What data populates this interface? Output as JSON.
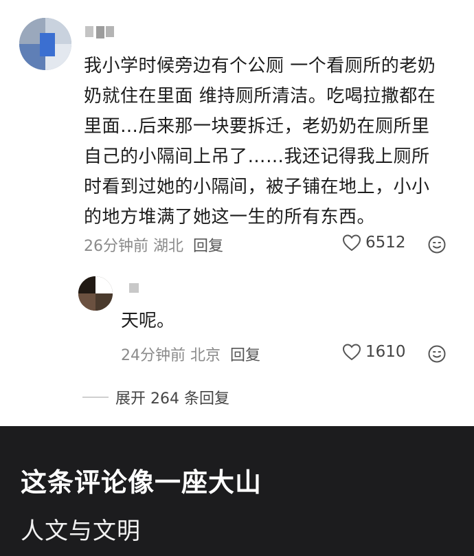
{
  "comment": {
    "lines": [
      "我小学时候旁边有个公厕 一个看厕所的老奶",
      "奶就住在里面 维持厕所清洁。吃喝拉撒都在",
      "里面…后来那一块要拆迁，老奶奶在厕所里",
      "自己的小隔间上吊了……我还记得我上厕所",
      "时看到过她的小隔间，被子铺在地上，小小",
      "的地方堆满了她这一生的所有东西。"
    ],
    "time_location": "26分钟前 湖北",
    "reply_label": "回复",
    "like_count": "6512",
    "like_icon": "heart-outline",
    "emoji_icon": "smiley-face"
  },
  "reply": {
    "text": "天呢。",
    "time_location": "24分钟前 北京",
    "reply_label": "回复",
    "like_count": "1610",
    "like_icon": "heart-outline",
    "emoji_icon": "smiley-face"
  },
  "expand": {
    "label": "展开 264 条回复"
  },
  "banner": {
    "title": "这条评论像一座大山",
    "subtitle": "人文与文明",
    "background": "#1c1c1e"
  }
}
